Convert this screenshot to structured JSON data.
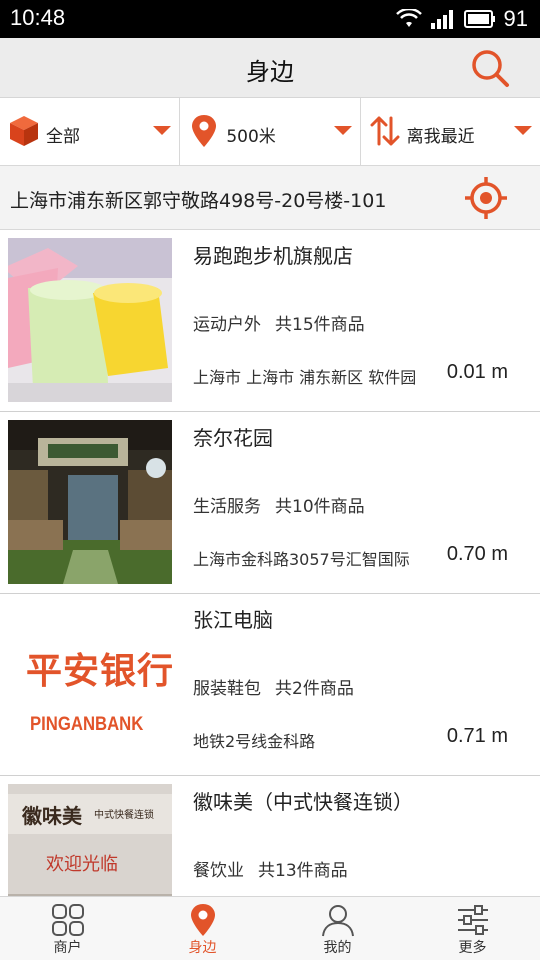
{
  "status_bar": {
    "time": "10:48",
    "battery": "91"
  },
  "header": {
    "title": "身边"
  },
  "filters": [
    {
      "label": "全部",
      "icon": "cube-icon"
    },
    {
      "label": "500米",
      "icon": "location-pin-icon"
    },
    {
      "label": "离我最近",
      "icon": "sort-arrows-icon"
    }
  ],
  "address": {
    "text": "上海市浦东新区郭守敬路498号-20号楼-101"
  },
  "shops": [
    {
      "name": "易跑跑步机旗舰店",
      "category": "运动户外",
      "count": "共15件商品",
      "address": "上海市 上海市 浦东新区 软件园",
      "distance": "0.01 m",
      "thumb": "jelly-photo"
    },
    {
      "name": "奈尔花园",
      "category": "生活服务",
      "count": "共10件商品",
      "address": "上海市金科路3057号汇智国际",
      "distance": "0.70 m",
      "thumb": "garden-photo"
    },
    {
      "name": "张江电脑",
      "category": "服装鞋包",
      "count": "共2件商品",
      "address": "地铁2号线金科路",
      "distance": "0.71 m",
      "thumb": "pingan-logo",
      "logo_text_cn": "平安银行",
      "logo_text_en": "PINGANBANK"
    },
    {
      "name": "徽味美（中式快餐连锁）",
      "category": "餐饮业",
      "count": "共13件商品",
      "address": "",
      "distance": "",
      "thumb": "restaurant-photo",
      "sign_text_cn": "徽味美",
      "sign_sub": "中式快餐连锁",
      "sign_welcome": "欢迎光临"
    }
  ],
  "tabs": [
    {
      "label": "商户",
      "icon": "grid-icon",
      "active": false
    },
    {
      "label": "身边",
      "icon": "location-pin-icon",
      "active": true
    },
    {
      "label": "我的",
      "icon": "user-icon",
      "active": false
    },
    {
      "label": "更多",
      "icon": "settings-sliders-icon",
      "active": false
    }
  ],
  "colors": {
    "accent": "#e2542a",
    "header_bg": "#ececec",
    "address_bg": "#f3f3f3"
  }
}
